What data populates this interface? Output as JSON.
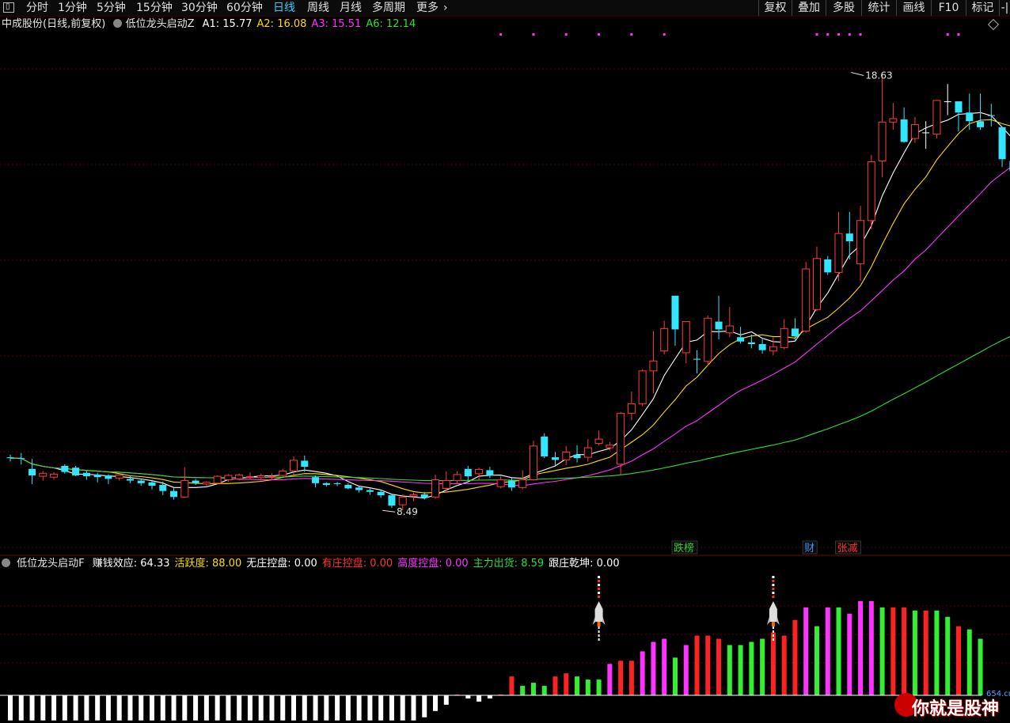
{
  "toolbar": {
    "window_icon": "window-icon",
    "periods": [
      {
        "label": "分时",
        "active": false
      },
      {
        "label": "1分钟",
        "active": false
      },
      {
        "label": "5分钟",
        "active": false
      },
      {
        "label": "15分钟",
        "active": false
      },
      {
        "label": "30分钟",
        "active": false
      },
      {
        "label": "60分钟",
        "active": false
      },
      {
        "label": "日线",
        "active": true
      },
      {
        "label": "周线",
        "active": false
      },
      {
        "label": "月线",
        "active": false
      },
      {
        "label": "多周期",
        "active": false
      },
      {
        "label": "更多",
        "active": false
      }
    ],
    "more_chevron": "›",
    "right_buttons": [
      "复权",
      "叠加",
      "多股",
      "统计",
      "画线",
      "F10",
      "标记",
      "-|"
    ]
  },
  "main_legend": {
    "stock": "中成股份(日线,前复权)",
    "indicator": "低位龙头启动Z",
    "items": [
      {
        "label": "A1:",
        "value": "15.77",
        "color": "#ffffff"
      },
      {
        "label": "A2:",
        "value": "16.08",
        "color": "#ffdd00"
      },
      {
        "label": "A3:",
        "value": "15.51",
        "color": "#ff33ff"
      },
      {
        "label": "A6:",
        "value": "12.14",
        "color": "#33dd33"
      }
    ],
    "corner_icon": "diamond-icon"
  },
  "sub_legend": {
    "indicator": "低位龙头启动F",
    "items": [
      {
        "label": "赚钱效应:",
        "value": "64.33",
        "color": "#ffffff"
      },
      {
        "label": "活跃度:",
        "value": "88.00",
        "color": "#ffdd00"
      },
      {
        "label": "无庄控盘:",
        "value": "0.00",
        "color": "#ffffff"
      },
      {
        "label": "有庄控盘:",
        "value": "0.00",
        "color": "#ff3333"
      },
      {
        "label": "高度控盘:",
        "value": "0.00",
        "color": "#ff33ff"
      },
      {
        "label": "主力出货:",
        "value": "8.59",
        "color": "#33dd33"
      },
      {
        "label": "跟庄乾坤:",
        "value": "0.00",
        "color": "#ffffff"
      }
    ]
  },
  "tags": [
    {
      "label": "跌榜",
      "color": "#33cc33",
      "idx": 61
    },
    {
      "label": "财",
      "color": "#3399ff",
      "idx": 73
    },
    {
      "label": "张减",
      "color": "#ff3333",
      "idx": 76
    }
  ],
  "watermark": {
    "text": "你就是股神",
    "small": "654.cn"
  },
  "colors": {
    "up": "#ff3b3b",
    "down": "#33e6ff",
    "doji": "#ffffff",
    "ma1": "#ffffff",
    "ma2": "#ffdd00",
    "ma3": "#ff33ff",
    "ma4": "#33dd33",
    "bar_green": "#33ee33",
    "bar_red": "#ff2222",
    "bar_magenta": "#ff33ff",
    "bar_white": "#ffffff",
    "grid": "#5a0000"
  },
  "chart_data": [
    {
      "type": "candlestick",
      "title": "中成股份(日线,前复权)",
      "ylim": [
        8.0,
        19.5
      ],
      "annotations": [
        {
          "text": "18.63",
          "idx": 77,
          "price": 18.63,
          "kind": "high"
        },
        {
          "text": "8.49",
          "idx": 34,
          "price": 8.49,
          "kind": "low"
        }
      ],
      "signal_dots_idx": [
        45,
        48,
        51,
        54,
        57,
        60,
        74,
        75,
        76,
        77,
        78,
        86,
        87
      ],
      "candles": [
        [
          9.72,
          9.78,
          9.62,
          9.7
        ],
        [
          9.7,
          9.82,
          9.55,
          9.69
        ],
        [
          9.45,
          9.68,
          9.1,
          9.3
        ],
        [
          9.28,
          9.4,
          9.18,
          9.35
        ],
        [
          9.26,
          9.38,
          9.2,
          9.33
        ],
        [
          9.52,
          9.56,
          9.34,
          9.38
        ],
        [
          9.48,
          9.52,
          9.28,
          9.3
        ],
        [
          9.36,
          9.4,
          9.2,
          9.28
        ],
        [
          9.32,
          9.36,
          9.14,
          9.26
        ],
        [
          9.3,
          9.33,
          9.1,
          9.22
        ],
        [
          9.24,
          9.34,
          9.18,
          9.31
        ],
        [
          9.22,
          9.28,
          9.12,
          9.18
        ],
        [
          9.18,
          9.22,
          9.06,
          9.12
        ],
        [
          9.14,
          9.2,
          8.98,
          9.06
        ],
        [
          9.08,
          9.16,
          8.84,
          8.94
        ],
        [
          8.94,
          9.02,
          8.74,
          8.8
        ],
        [
          8.8,
          9.49,
          8.78,
          9.18
        ],
        [
          9.18,
          9.22,
          9.08,
          9.12
        ],
        [
          9.1,
          9.16,
          9.06,
          9.14
        ],
        [
          9.12,
          9.3,
          9.1,
          9.28
        ],
        [
          9.2,
          9.33,
          9.15,
          9.3
        ],
        [
          9.22,
          9.34,
          9.19,
          9.31
        ],
        [
          9.26,
          9.37,
          9.2,
          9.27
        ],
        [
          9.25,
          9.34,
          9.18,
          9.29
        ],
        [
          9.26,
          9.35,
          9.2,
          9.28
        ],
        [
          9.3,
          9.45,
          9.28,
          9.4
        ],
        [
          9.4,
          9.74,
          9.3,
          9.65
        ],
        [
          9.64,
          9.76,
          9.38,
          9.5
        ],
        [
          9.26,
          9.3,
          9.02,
          9.12
        ],
        [
          9.12,
          9.14,
          9.04,
          9.08
        ],
        [
          9.12,
          9.15,
          9.05,
          9.1
        ],
        [
          9.08,
          9.12,
          8.98,
          9.0
        ],
        [
          9.02,
          9.06,
          8.9,
          8.96
        ],
        [
          8.96,
          9.0,
          8.85,
          8.92
        ],
        [
          8.92,
          8.96,
          8.78,
          8.84
        ],
        [
          8.84,
          8.88,
          8.55,
          8.6
        ],
        [
          8.62,
          8.86,
          8.49,
          8.8
        ],
        [
          8.82,
          8.9,
          8.7,
          8.85
        ],
        [
          8.86,
          8.92,
          8.74,
          8.78
        ],
        [
          8.8,
          9.32,
          8.76,
          9.2
        ],
        [
          9.0,
          9.4,
          8.9,
          9.18
        ],
        [
          9.18,
          9.4,
          9.1,
          9.32
        ],
        [
          9.45,
          9.52,
          9.18,
          9.28
        ],
        [
          9.34,
          9.48,
          9.2,
          9.44
        ],
        [
          9.42,
          9.5,
          9.24,
          9.3
        ],
        [
          9.04,
          9.28,
          9.0,
          9.2
        ],
        [
          9.18,
          9.24,
          8.94,
          9.02
        ],
        [
          9.02,
          9.42,
          8.98,
          9.2
        ],
        [
          9.2,
          10.1,
          9.18,
          9.98
        ],
        [
          10.2,
          10.28,
          9.7,
          9.74
        ],
        [
          9.72,
          9.84,
          9.5,
          9.66
        ],
        [
          9.66,
          9.98,
          9.54,
          9.84
        ],
        [
          9.78,
          10.0,
          9.6,
          9.7
        ],
        [
          9.72,
          10.14,
          9.62,
          9.94
        ],
        [
          10.04,
          10.34,
          10.0,
          10.14
        ],
        [
          9.94,
          10.07,
          9.88,
          10.0
        ],
        [
          9.56,
          10.77,
          9.3,
          10.74
        ],
        [
          10.74,
          11.24,
          10.58,
          10.96
        ],
        [
          10.96,
          11.76,
          10.9,
          11.72
        ],
        [
          11.72,
          12.64,
          11.2,
          11.95
        ],
        [
          12.18,
          12.88,
          12.1,
          12.7
        ],
        [
          13.46,
          13.46,
          12.3,
          12.68
        ],
        [
          12.14,
          12.86,
          11.9,
          12.86
        ],
        [
          12.0,
          12.2,
          11.66,
          11.98
        ],
        [
          11.94,
          13.0,
          11.84,
          12.94
        ],
        [
          12.86,
          13.46,
          12.45,
          12.68
        ],
        [
          12.6,
          13.2,
          12.5,
          12.76
        ],
        [
          12.5,
          12.74,
          12.35,
          12.4
        ],
        [
          12.38,
          12.56,
          12.24,
          12.34
        ],
        [
          12.34,
          12.48,
          12.12,
          12.2
        ],
        [
          12.18,
          12.5,
          12.08,
          12.28
        ],
        [
          12.26,
          12.92,
          12.22,
          12.7
        ],
        [
          12.7,
          12.94,
          12.44,
          12.52
        ],
        [
          12.64,
          14.24,
          12.6,
          14.08
        ],
        [
          13.14,
          14.6,
          13.1,
          14.32
        ],
        [
          14.3,
          14.38,
          13.94,
          14.0
        ],
        [
          14.0,
          15.4,
          13.8,
          14.9
        ],
        [
          14.9,
          15.4,
          14.3,
          14.72
        ],
        [
          14.2,
          15.54,
          13.8,
          15.2
        ],
        [
          15.2,
          16.72,
          15.0,
          16.56
        ],
        [
          16.58,
          18.63,
          16.2,
          17.48
        ],
        [
          17.48,
          17.92,
          17.3,
          17.56
        ],
        [
          17.54,
          17.82,
          17.0,
          17.02
        ],
        [
          17.1,
          17.6,
          17.0,
          17.42
        ],
        [
          17.24,
          17.5,
          16.86,
          17.24
        ],
        [
          17.2,
          17.84,
          17.1,
          17.98
        ],
        [
          17.96,
          18.36,
          17.64,
          17.96
        ],
        [
          17.96,
          17.92,
          17.26,
          17.7
        ],
        [
          17.7,
          18.14,
          17.3,
          17.5
        ],
        [
          17.5,
          18.14,
          17.3,
          17.36
        ],
        [
          17.64,
          17.9,
          17.38,
          17.62
        ],
        [
          17.36,
          17.2,
          16.44,
          16.62
        ],
        [
          16.58,
          16.98,
          16.1,
          16.34
        ],
        [
          16.4,
          16.56,
          15.32,
          15.8
        ]
      ],
      "ma_colors": [
        "#ffffff",
        "#ffdd00",
        "#ff33ff",
        "#33dd33"
      ]
    },
    {
      "type": "bar",
      "title": "低位龙头启动F",
      "ylim": [
        -8,
        34
      ],
      "rocket_idx": [
        54,
        70
      ],
      "series": [
        {
          "values": [
            -8,
            -8,
            -8,
            -8,
            -8,
            -8,
            -8,
            -8,
            -8,
            -8,
            -8,
            -8,
            -8,
            -8,
            -8,
            -8,
            -8,
            -8,
            -8,
            -8,
            -8,
            -8,
            -8,
            -8,
            -8,
            -8,
            -8,
            -8,
            -8,
            -8,
            -8,
            -8,
            -8,
            -8,
            -8,
            -8,
            -8,
            -8,
            -7,
            -5,
            -3,
            0,
            -1,
            -2,
            -1,
            0,
            6,
            3,
            4,
            3,
            6,
            7,
            6,
            5,
            5,
            10,
            11,
            11,
            14,
            17,
            18,
            12,
            16,
            19,
            19,
            18,
            16,
            16,
            17,
            18,
            20,
            19,
            24,
            28,
            22,
            28,
            28,
            26,
            30,
            30,
            28,
            28,
            28,
            27,
            27,
            27,
            25,
            22,
            21,
            18
          ]
        }
      ],
      "colors": [
        "white",
        "white",
        "white",
        "white",
        "white",
        "white",
        "white",
        "white",
        "white",
        "white",
        "white",
        "white",
        "white",
        "white",
        "white",
        "white",
        "white",
        "white",
        "white",
        "white",
        "white",
        "white",
        "white",
        "white",
        "white",
        "white",
        "white",
        "white",
        "white",
        "white",
        "white",
        "white",
        "white",
        "white",
        "white",
        "white",
        "white",
        "white",
        "white",
        "white",
        "white",
        "red",
        "white",
        "white",
        "white",
        "red",
        "red",
        "green",
        "green",
        "green",
        "red",
        "red",
        "green",
        "green",
        "green",
        "magenta",
        "red",
        "red",
        "magenta",
        "magenta",
        "magenta",
        "green",
        "magenta",
        "red",
        "red",
        "red",
        "green",
        "green",
        "green",
        "green",
        "red",
        "red",
        "red",
        "magenta",
        "green",
        "magenta",
        "green",
        "magenta",
        "magenta",
        "magenta",
        "green",
        "red",
        "red",
        "green",
        "red",
        "green",
        "green",
        "red",
        "green",
        "green",
        "green"
      ]
    }
  ]
}
